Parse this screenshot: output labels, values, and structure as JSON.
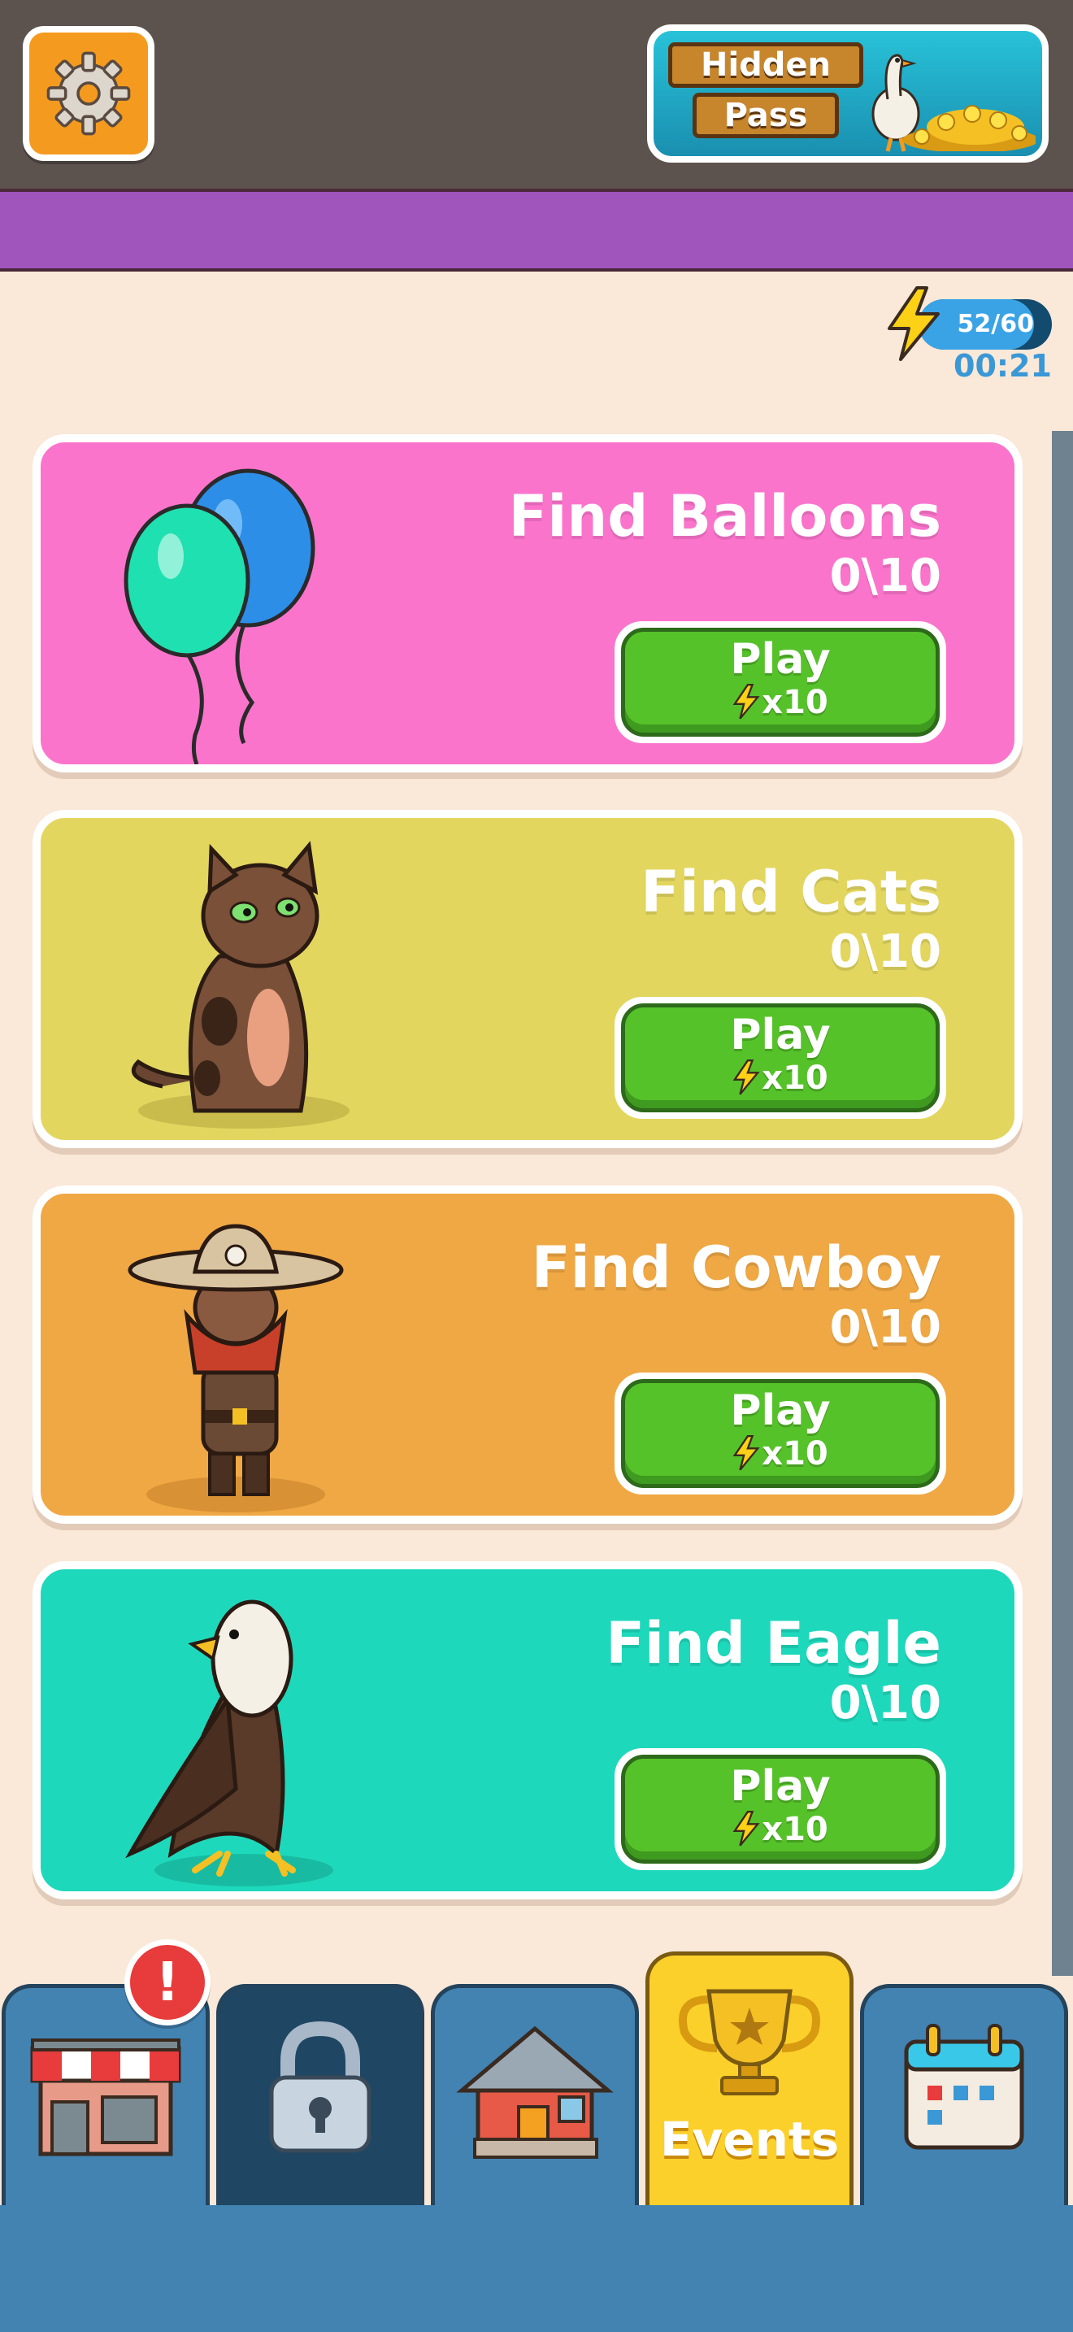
{
  "header": {
    "settings_icon": "gear-icon",
    "hidden_pass": {
      "line1": "Hidden",
      "line2": "Pass"
    }
  },
  "energy": {
    "count": "52/60",
    "current": 52,
    "max": 60,
    "timer": "00:21",
    "icon": "lightning-bolt-icon"
  },
  "events": [
    {
      "title": "Find Balloons",
      "progress": "0\\10",
      "play_label": "Play",
      "cost": "x10",
      "color": "#fb74cc",
      "art": "balloons-icon"
    },
    {
      "title": "Find Cats",
      "progress": "0\\10",
      "play_label": "Play",
      "cost": "x10",
      "color": "#e3d65f",
      "art": "cat-icon"
    },
    {
      "title": "Find Cowboy",
      "progress": "0\\10",
      "play_label": "Play",
      "cost": "x10",
      "color": "#f0a844",
      "art": "cowboy-icon"
    },
    {
      "title": "Find Eagle",
      "progress": "0\\10",
      "play_label": "Play",
      "cost": "x10",
      "color": "#1ed8bc",
      "art": "eagle-icon"
    }
  ],
  "nav": {
    "tabs": [
      {
        "icon": "shop-icon",
        "badge": "!"
      },
      {
        "icon": "lock-icon"
      },
      {
        "icon": "house-icon"
      },
      {
        "icon": "trophy-icon",
        "label": "Events",
        "active": true
      },
      {
        "icon": "calendar-icon"
      }
    ]
  },
  "colors": {
    "background": "#fae8d8",
    "topbar": "#5c534e",
    "purple_bar": "#a055bd",
    "play_green": "#56c22a",
    "nav_blue": "#4283b2",
    "active_tab": "#fbd02a"
  }
}
